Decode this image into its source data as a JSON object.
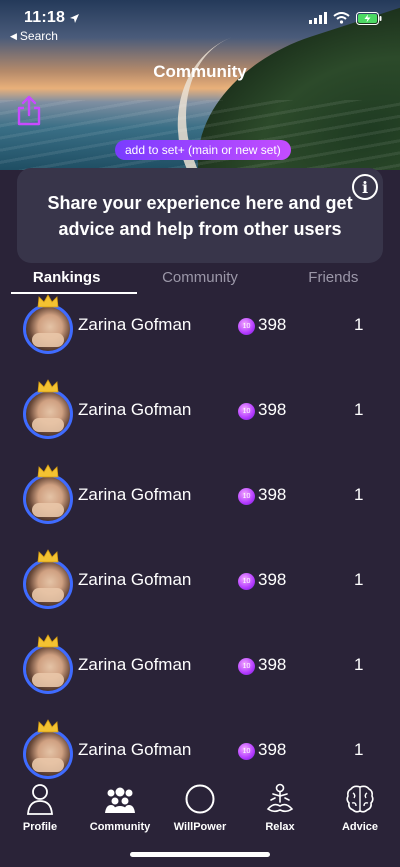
{
  "status_bar": {
    "time": "11:18",
    "back_label": "Search"
  },
  "header": {
    "title": "Community",
    "add_to_set_label": "add to set+ (main or new set)"
  },
  "info_card": {
    "text": "Share your experience here and get advice and help from other users",
    "info_glyph": "i"
  },
  "tabs": [
    {
      "label": "Rankings",
      "active": true
    },
    {
      "label": "Community",
      "active": false
    },
    {
      "label": "Friends",
      "active": false
    }
  ],
  "rankings": [
    {
      "name": "Zarina Gofman",
      "coin_glyph": "10",
      "points": "398",
      "rank": "1"
    },
    {
      "name": "Zarina Gofman",
      "coin_glyph": "10",
      "points": "398",
      "rank": "1"
    },
    {
      "name": "Zarina Gofman",
      "coin_glyph": "10",
      "points": "398",
      "rank": "1"
    },
    {
      "name": "Zarina Gofman",
      "coin_glyph": "10",
      "points": "398",
      "rank": "1"
    },
    {
      "name": "Zarina Gofman",
      "coin_glyph": "10",
      "points": "398",
      "rank": "1"
    },
    {
      "name": "Zarina Gofman",
      "coin_glyph": "10",
      "points": "398",
      "rank": "1"
    }
  ],
  "bottom_nav": [
    {
      "label": "Profile",
      "icon": "person-icon"
    },
    {
      "label": "Community",
      "icon": "group-icon"
    },
    {
      "label": "WillPower",
      "icon": "circle-icon"
    },
    {
      "label": "Relax",
      "icon": "meditation-icon"
    },
    {
      "label": "Advice",
      "icon": "brain-icon"
    }
  ],
  "colors": {
    "background": "#2a2338",
    "card": "#38354a",
    "accent_purple": "#b43bff",
    "avatar_ring": "#3f6bff",
    "battery_green": "#4cd964"
  }
}
